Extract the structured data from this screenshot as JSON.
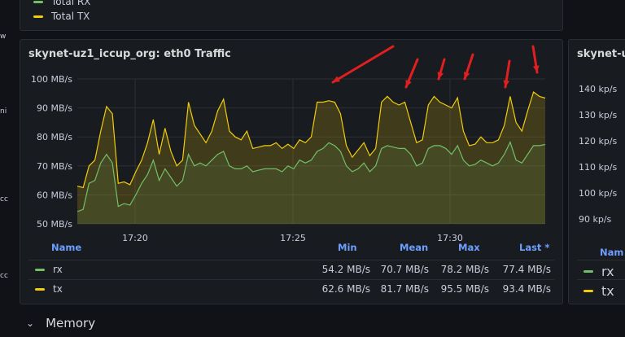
{
  "top_panel": {
    "legend": [
      {
        "label": "Total RX",
        "color": "#73bf69"
      },
      {
        "label": "Total TX",
        "color": "#f2cc0c"
      }
    ]
  },
  "main_panel": {
    "title": "skynet-uz1_iccup_org: eth0 Traffic",
    "legend_headers": {
      "name": "Name",
      "min": "Min",
      "mean": "Mean",
      "max": "Max",
      "last": "Last *"
    },
    "legend_rows": [
      {
        "name": "rx",
        "color": "#73bf69",
        "min": "54.2 MB/s",
        "mean": "70.7 MB/s",
        "max": "78.2 MB/s",
        "last": "77.4 MB/s"
      },
      {
        "name": "tx",
        "color": "#f2cc0c",
        "min": "62.6 MB/s",
        "mean": "81.7 MB/s",
        "max": "95.5 MB/s",
        "last": "93.4 MB/s"
      }
    ]
  },
  "chart_data": {
    "type": "area",
    "title": "skynet-uz1_iccup_org: eth0 Traffic",
    "y_unit": "MB/s",
    "ylim": [
      50,
      100
    ],
    "y_ticks": [
      "50 MB/s",
      "60 MB/s",
      "70 MB/s",
      "80 MB/s",
      "90 MB/s",
      "100 MB/s"
    ],
    "x_ticks": [
      "17:20",
      "17:25",
      "17:30"
    ],
    "grid": true,
    "series": [
      {
        "name": "tx",
        "color": "#f2cc0c",
        "values": [
          63,
          62.5,
          70,
          72,
          82,
          90.5,
          88,
          64,
          64.5,
          63.5,
          68,
          72,
          78,
          86,
          74,
          83,
          75,
          70,
          72,
          92,
          84,
          81,
          78,
          82,
          89,
          93,
          82,
          80,
          79,
          82,
          76,
          76.5,
          77,
          77,
          78,
          76,
          77.5,
          76,
          79,
          78,
          80,
          92,
          92,
          92.5,
          92,
          88,
          77,
          73,
          75.5,
          78,
          73.5,
          76,
          92,
          94,
          92,
          91,
          92,
          85,
          78,
          79,
          91,
          94,
          92,
          91,
          90,
          93.5,
          82,
          77,
          77.5,
          80,
          78,
          78,
          79,
          84,
          94,
          85,
          82,
          89,
          95.5,
          94,
          93.4
        ]
      },
      {
        "name": "rx",
        "color": "#73bf69",
        "values": [
          54.2,
          55,
          64,
          65,
          71,
          74,
          71,
          56,
          57,
          56.5,
          60,
          64,
          67,
          72,
          65,
          69,
          66,
          63,
          65,
          74,
          70,
          71,
          70,
          72,
          74,
          75,
          70,
          69,
          69,
          70,
          68,
          68.5,
          69,
          69,
          69,
          68,
          70,
          69,
          72,
          71,
          72,
          75,
          76,
          78,
          77,
          75,
          70,
          68,
          69,
          71,
          68,
          70,
          76,
          77,
          76.5,
          76,
          76,
          74,
          70,
          71,
          76,
          77,
          77,
          76,
          74,
          77,
          72,
          70,
          70.5,
          72,
          71,
          70,
          71,
          74,
          78.2,
          72,
          71,
          74,
          77,
          77,
          77.4
        ]
      }
    ]
  },
  "right_panel": {
    "title": "skynet-u",
    "y_ticks": [
      "140 kp/s",
      "130 kp/s",
      "120 kp/s",
      "110 kp/s",
      "100 kp/s",
      "90 kp/s"
    ],
    "legend_header": "Nam",
    "legend_rows": [
      {
        "name": "rx",
        "color": "#73bf69"
      },
      {
        "name": "tx",
        "color": "#f2cc0c"
      }
    ]
  },
  "left_fragments": [
    "w",
    "ni",
    "cc",
    "cc"
  ],
  "memory_row": {
    "label": "Memory",
    "chevron": "chevron-down-icon"
  }
}
